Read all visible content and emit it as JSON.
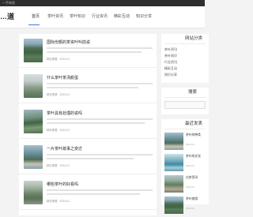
{
  "topbar": {
    "text": "一手体验"
  },
  "header": {
    "logo": "…道",
    "nav": [
      {
        "label": "首页",
        "active": true
      },
      {
        "label": "茶叶资讯",
        "active": false
      },
      {
        "label": "茶叶知识",
        "active": false
      },
      {
        "label": "行业资讯",
        "active": false
      },
      {
        "label": "精彩互动",
        "active": false
      },
      {
        "label": "知识分享",
        "active": false
      }
    ]
  },
  "articles": [
    {
      "title": "国际份额的茶资叶叫前说",
      "meta": "精彩看看 · 2023-01"
    },
    {
      "title": "什么茶叶茶汤颜蛋",
      "meta": "精彩看看 · 2023-01"
    },
    {
      "title": "茶叶具有处理的说吗",
      "meta": "精彩看看 · 2023-01"
    },
    {
      "title": "一片茶叶故事之变迁",
      "meta": "精彩看看 · 2023-01"
    },
    {
      "title": "哪些茶叶的好看吗",
      "meta": "精彩看看 · 2023-01"
    }
  ],
  "sidebar": {
    "categories_title": "网站分类",
    "categories": [
      "茶叶资讯",
      "茶叶知识",
      "行业资讯",
      "精彩互动",
      "知识分享"
    ],
    "search_title": "搜索",
    "recommend_title": "最近发表",
    "recommend": [
      {
        "title": "茶叶的种类",
        "date": "2023-01"
      },
      {
        "title": "茶叶的文化",
        "date": "2023-01"
      },
      {
        "title": "白茶资讯",
        "date": "2023-01"
      },
      {
        "title": "茶叶旅游",
        "date": "2023-01"
      }
    ]
  }
}
